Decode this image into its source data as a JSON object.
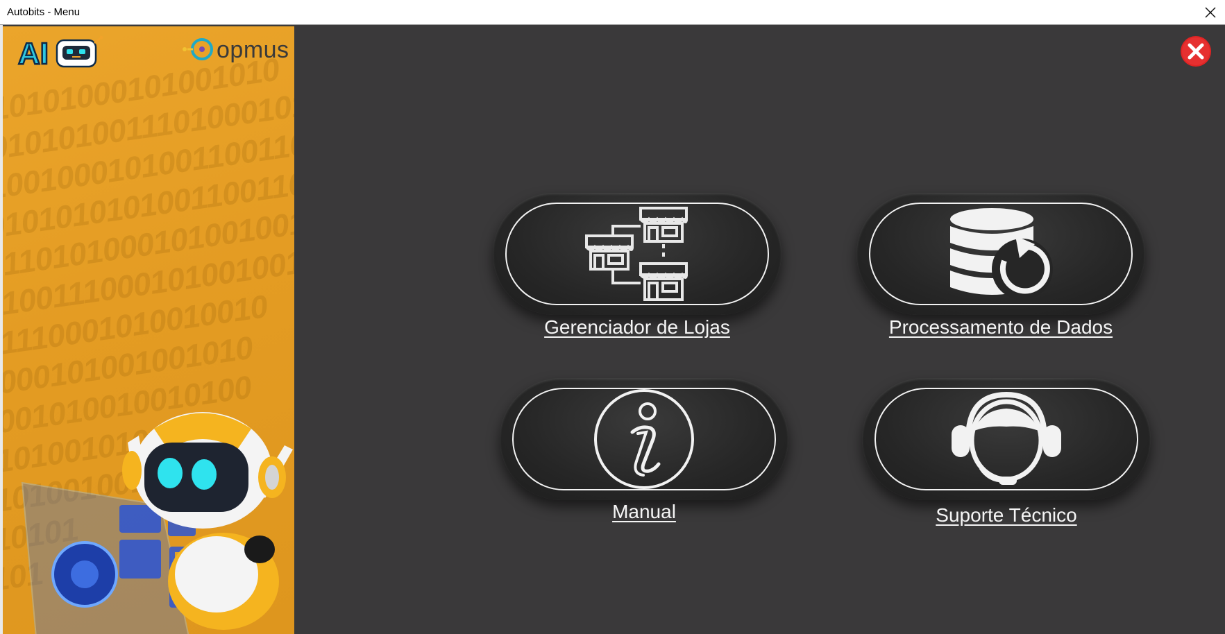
{
  "window": {
    "title": "Autobits - Menu",
    "close_glyph": "✕"
  },
  "sidebar": {
    "ai_logo_text": "AI",
    "brand_name": "opmus",
    "binary_lines": [
      "10101000101001010",
      "0101010011101000101010",
      "10010001010011001100",
      "0101010101001100110",
      "01101010001010010010",
      "0100111000101001001",
      "01110001010010010",
      "1000101001001010",
      "0001010010010100",
      "0101001010010",
      "01010010010",
      "010101",
      "0101"
    ]
  },
  "menu": {
    "items": [
      {
        "id": "stores",
        "label": "Gerenciador de Lojas",
        "icon": "stores-network-icon"
      },
      {
        "id": "data",
        "label": "Processamento de Dados",
        "icon": "database-refresh-icon"
      },
      {
        "id": "manual",
        "label": "Manual",
        "icon": "info-icon"
      },
      {
        "id": "support",
        "label": "Suporte Técnico",
        "icon": "headset-support-icon"
      }
    ]
  },
  "colors": {
    "background": "#3a393a",
    "sidebar": "#e49c23",
    "close_red": "#e02424",
    "robot_eye": "#2fe3ee",
    "brand_teal": "#1fa9c6"
  }
}
